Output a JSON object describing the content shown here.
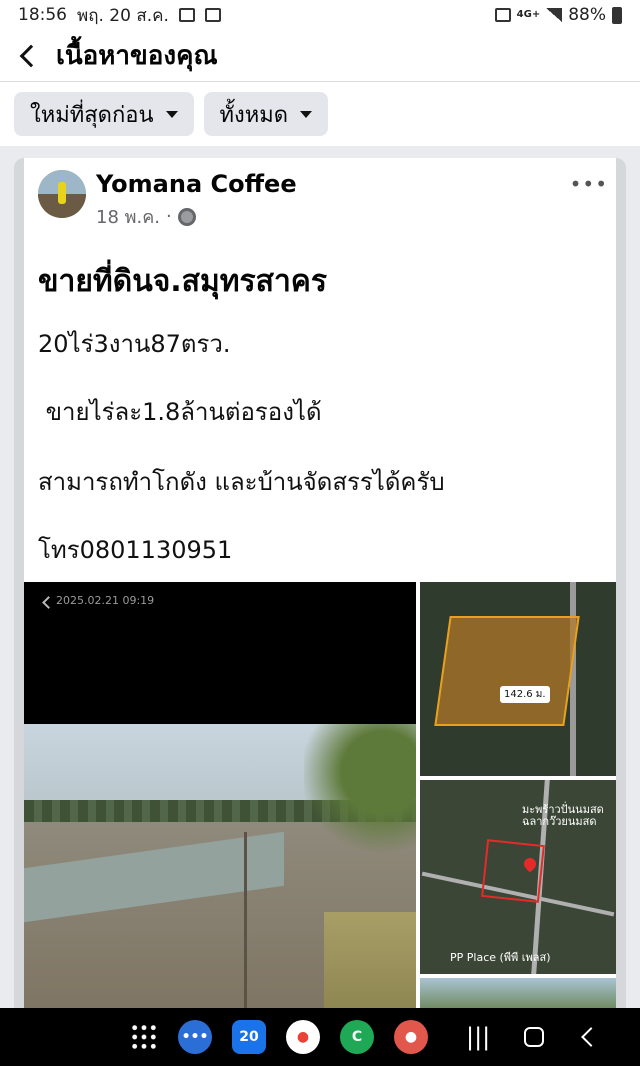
{
  "status_bar": {
    "time": "18:56",
    "date": "พฤ. 20 ส.ค.",
    "network": "4G+",
    "battery": "88%"
  },
  "header": {
    "title": "เนื้อหาของคุณ"
  },
  "filters": [
    {
      "label": "ใหม่ที่สุดก่อน"
    },
    {
      "label": "ทั้งหมด"
    }
  ],
  "post": {
    "page_name": "Yomana Coffee",
    "date": "18 พ.ค.",
    "separator": "·",
    "title": "ขายที่ดินจ.สมุทรสาคร",
    "lines": [
      "20ไร่3งาน87ตรว.",
      " ขายไร่ละ1.8ล้านต่อรองได้",
      "สามารถทำโกดัง และบ้านจัดสรรได้ครับ",
      "โทร0801130951"
    ],
    "photo_main_date": "2025.02.21 09:19",
    "map1_label": "142.6 ม.",
    "map2_place": "มะพร้าวปั่นนมสด\nฉลากว๊วยนมสด",
    "map2_pp": "PP Place (พีพี เพลส)"
  },
  "navbar": {
    "calendar_day": "20"
  },
  "colors": {
    "accent": "#1877f2",
    "chip_bg": "#e4e6eb",
    "plot_outline": "#e8a020",
    "plot2_outline": "#e52a2a"
  }
}
